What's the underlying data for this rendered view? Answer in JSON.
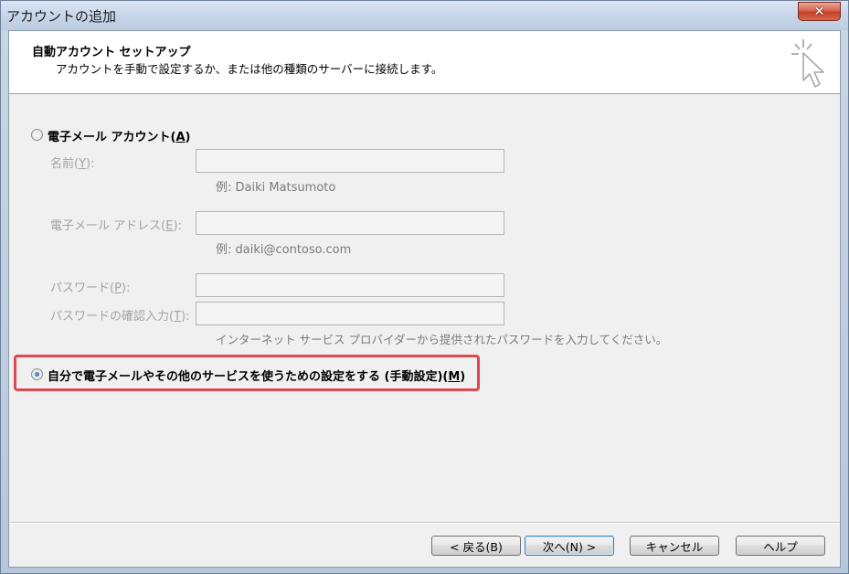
{
  "window": {
    "title": "アカウントの追加",
    "close_label": "✕"
  },
  "header": {
    "title": "自動アカウント セットアップ",
    "subtitle": "アカウントを手動で設定するか、または他の種類のサーバーに接続します。"
  },
  "options": {
    "email_account": {
      "label_main": "電子メール アカウント(",
      "label_key": "A",
      "label_end": ")",
      "selected": false
    },
    "manual": {
      "label_main": "自分で電子メールやその他のサービスを使うための設定をする (手動設定)(",
      "label_key": "M",
      "label_end": ")",
      "selected": true
    }
  },
  "form": {
    "name": {
      "label_main": "名前(",
      "label_key": "Y",
      "label_end": "):",
      "value": "",
      "example": "例: Daiki Matsumoto"
    },
    "email": {
      "label_main": "電子メール アドレス(",
      "label_key": "E",
      "label_end": "):",
      "value": "",
      "example": "例: daiki@contoso.com"
    },
    "password": {
      "label_main": "パスワード(",
      "label_key": "P",
      "label_end": "):",
      "value": ""
    },
    "password_confirm": {
      "label_main": "パスワードの確認入力(",
      "label_key": "T",
      "label_end": "):",
      "value": ""
    },
    "password_hint": "インターネット サービス プロバイダーから提供されたパスワードを入力してください。"
  },
  "buttons": {
    "back": "< 戻る(B)",
    "next": "次へ(N) >",
    "cancel": "キャンセル",
    "help": "ヘルプ"
  },
  "colors": {
    "highlight": "#e0474f",
    "close_button": "#c24027"
  }
}
